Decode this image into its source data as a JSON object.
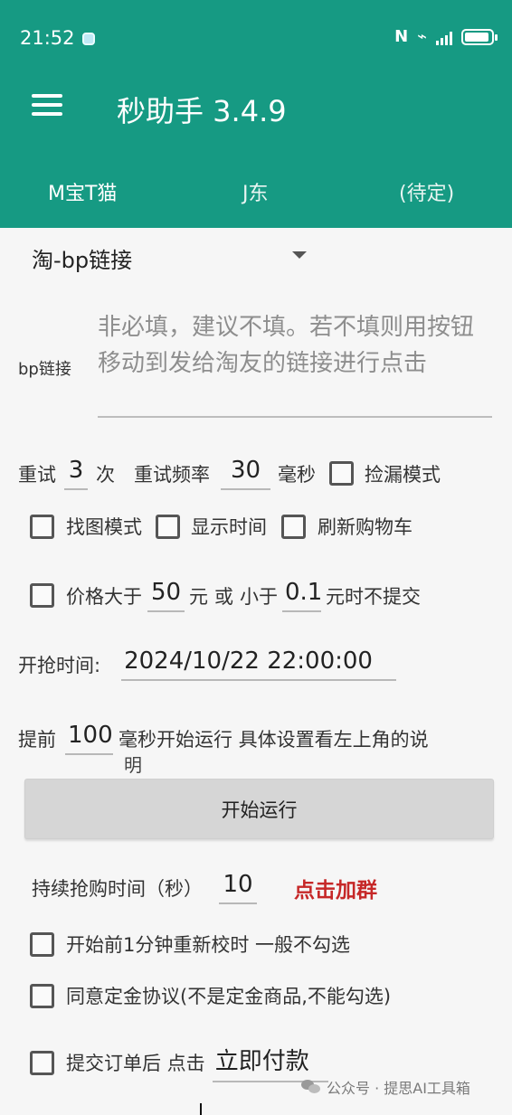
{
  "status_bar": {
    "time": "21:52",
    "icons": [
      "nfc-icon",
      "wifi-icon",
      "signal-icon",
      "battery-icon"
    ],
    "nfc_text": "N",
    "wifi_symbol": "⌁"
  },
  "appbar": {
    "title": "秒助手 3.4.9",
    "color": "#169a83"
  },
  "tabs": [
    {
      "label": "M宝T猫"
    },
    {
      "label": "J东"
    },
    {
      "label": "(待定)"
    }
  ],
  "dropdown": {
    "selected": "淘-bp链接"
  },
  "bp_link": {
    "label": "bp链接",
    "placeholder": "非必填，建议不填。若不填则用按钮移动到发给淘友的链接进行点击"
  },
  "retry": {
    "label": "重试",
    "count": "3",
    "count_unit": "次",
    "frequency_label": "重试频率",
    "frequency": "30",
    "frequency_unit": "毫秒",
    "leak_mode": "捡漏模式"
  },
  "options": {
    "find_image": "找图模式",
    "show_time": "显示时间",
    "refresh_cart": "刷新购物车"
  },
  "price": {
    "prefix": "价格大于",
    "min": "50",
    "yuan": "元",
    "or": "或",
    "lt": "小于",
    "max": "0.1",
    "suffix": "元时不提交"
  },
  "schedule": {
    "label": "开抢时间:",
    "value": "2024/10/22 22:00:00"
  },
  "advance": {
    "label": "提前",
    "ms": "100",
    "text": "毫秒开始运行 具体设置看左上角的说",
    "wrap": "明"
  },
  "start_button": {
    "label": "开始运行"
  },
  "duration": {
    "label": "持续抢购时间（秒）",
    "value": "10",
    "group_link": "点击加群",
    "link_color": "#c62828"
  },
  "checks": [
    {
      "label": "开始前1分钟重新校时 一般不勾选"
    },
    {
      "label": "同意定金协议(不是定金商品,不能勾选)"
    }
  ],
  "submit": {
    "label": "提交订单后 点击",
    "action": "立即付款"
  },
  "watermark": {
    "text": "公众号 · 提思AI工具箱"
  }
}
